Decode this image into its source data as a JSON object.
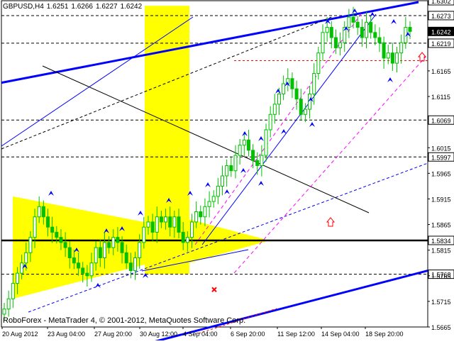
{
  "header": {
    "symbol": "GBPUSD,H4",
    "ohlc": [
      "1.6251",
      "1.6266",
      "1.6227",
      "1.6242"
    ]
  },
  "footer": {
    "copyright": "RoboForex - MetaTrader 4, © 2001-2012, MetaQuotes Software Corp."
  },
  "colors": {
    "background": "#ffffff",
    "candle": "#00c000",
    "zone": "#ffff00",
    "trend_blue": "#0000ff",
    "channel_magenta": "#ff00ff",
    "level_red": "#ff0000",
    "current_price_label": "#000000"
  },
  "chart_data": {
    "type": "candlestick",
    "timeframe": "H4",
    "ylim": [
      1.5665,
      1.6302
    ],
    "x_tick_labels": [
      "20 Aug 2012",
      "23 Aug 04:00",
      "27 Aug 20:00",
      "30 Aug 12:00",
      "4 Sep 04:00",
      "6 Sep 20:00",
      "11 Sep 12:00",
      "14 Sep 04:00",
      "18 Sep 20:00"
    ],
    "y_tick_labels": [
      "1.6302",
      "1.6273",
      "1.6242",
      "1.6219",
      "1.6165",
      "1.6115",
      "1.6069",
      "1.6015",
      "1.5997",
      "1.5965",
      "1.5915",
      "1.5865",
      "1.5834",
      "1.5815",
      "1.5768",
      "1.5765",
      "1.5715",
      "1.5665"
    ],
    "marked_levels": [
      {
        "price": 1.6302,
        "label": "1.6302",
        "style": "top"
      },
      {
        "price": 1.6273,
        "label": "1.6273",
        "style": "dashed"
      },
      {
        "price": 1.6242,
        "label": "1.6242",
        "style": "current"
      },
      {
        "price": 1.6219,
        "label": "1.6219",
        "style": "dashed"
      },
      {
        "price": 1.6069,
        "label": "1.6069",
        "style": "dashed"
      },
      {
        "price": 1.5997,
        "label": "1.5997",
        "style": "dashed"
      },
      {
        "price": 1.5834,
        "label": "1.5834",
        "style": "solid-thick"
      },
      {
        "price": 1.5768,
        "label": "1.5768",
        "style": "dashed"
      }
    ],
    "close_series": [
      1.57,
      1.572,
      1.575,
      1.577,
      1.579,
      1.581,
      1.584,
      1.588,
      1.59,
      1.588,
      1.586,
      1.585,
      1.584,
      1.583,
      1.582,
      1.58,
      1.579,
      1.578,
      1.577,
      1.5765,
      1.579,
      1.582,
      1.58,
      1.583,
      1.582,
      1.584,
      1.583,
      1.581,
      1.579,
      1.5775,
      1.58,
      1.583,
      1.586,
      1.587,
      1.585,
      1.588,
      1.587,
      1.588,
      1.586,
      1.588,
      1.585,
      1.583,
      1.584,
      1.587,
      1.589,
      1.588,
      1.59,
      1.591,
      1.592,
      1.594,
      1.596,
      1.598,
      1.597,
      1.6,
      1.602,
      1.603,
      1.601,
      1.599,
      1.598,
      1.6,
      1.605,
      1.608,
      1.61,
      1.612,
      1.614,
      1.615,
      1.613,
      1.611,
      1.608,
      1.609,
      1.612,
      1.616,
      1.62,
      1.624,
      1.625,
      1.623,
      1.621,
      1.622,
      1.625,
      1.627,
      1.626,
      1.625,
      1.623,
      1.626,
      1.624,
      1.623,
      1.622,
      1.619,
      1.62,
      1.618,
      1.62,
      1.622,
      1.625,
      1.6242
    ],
    "price_zone": {
      "from_date": "31 Aug",
      "to_date": "4 Sep",
      "low": 1.5768,
      "high": 1.6302
    },
    "annotation_arrows_up_price": 1.587,
    "annotation_cross_price": 1.5738
  }
}
